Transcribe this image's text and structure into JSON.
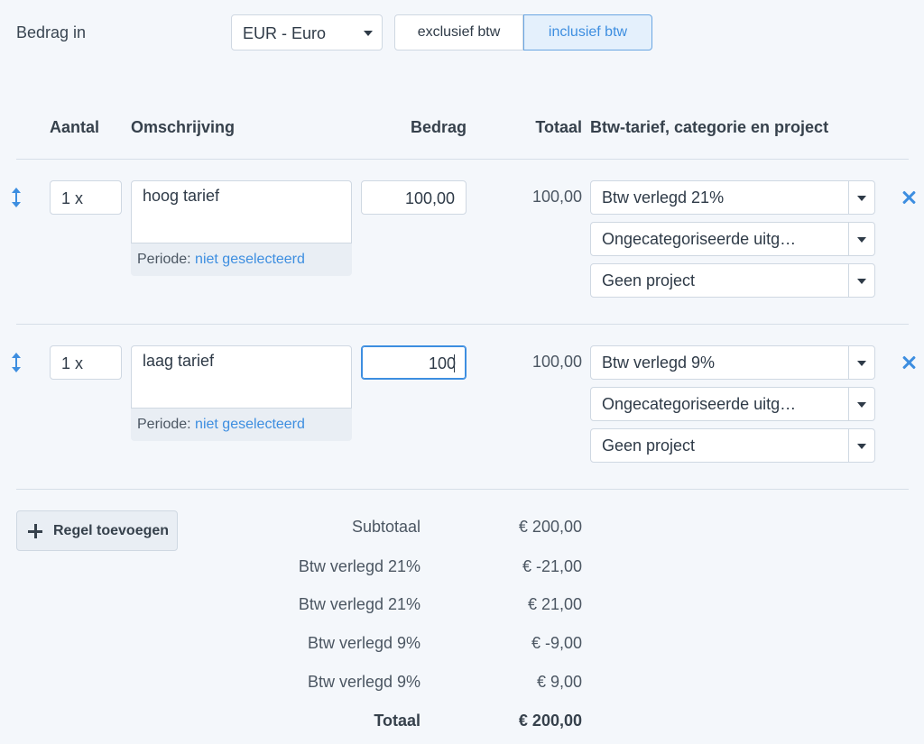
{
  "header": {
    "bedrag_in_label": "Bedrag in",
    "currency": "EUR - Euro",
    "toggle": {
      "exclusive": "exclusief btw",
      "inclusive": "inclusief btw",
      "selected": "inclusief btw"
    }
  },
  "columns": {
    "aantal": "Aantal",
    "omschrijving": "Omschrijving",
    "bedrag": "Bedrag",
    "totaal": "Totaal",
    "btw": "Btw-tarief, categorie en project"
  },
  "rows": [
    {
      "quantity": "1 x",
      "description": "hoog tarief",
      "periode_label": "Periode:",
      "periode_value": "niet geselecteerd",
      "amount": "100,00",
      "total": "100,00",
      "vat": "Btw verlegd 21%",
      "category": "Ongecategoriseerde uitg…",
      "project": "Geen project"
    },
    {
      "quantity": "1 x",
      "description": "laag tarief",
      "periode_label": "Periode:",
      "periode_value": "niet geselecteerd",
      "amount": "100",
      "total": "100,00",
      "vat": "Btw verlegd 9%",
      "category": "Ongecategoriseerde uitg…",
      "project": "Geen project"
    }
  ],
  "add_line_label": "Regel toevoegen",
  "summary": [
    {
      "label": "Subtotaal",
      "value": "€ 200,00"
    },
    {
      "label": "Btw verlegd 21%",
      "value": "€ -21,00"
    },
    {
      "label": "Btw verlegd 21%",
      "value": "€ 21,00"
    },
    {
      "label": "Btw verlegd 9%",
      "value": "€ -9,00"
    },
    {
      "label": "Btw verlegd 9%",
      "value": "€ 9,00"
    },
    {
      "label": "Totaal",
      "value": "€ 200,00"
    }
  ],
  "colors": {
    "accent": "#3d8ee0",
    "background": "#f4f7fb",
    "text": "#2e3a47"
  }
}
